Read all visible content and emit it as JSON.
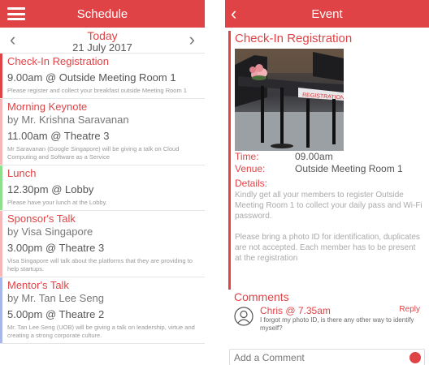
{
  "schedule": {
    "header": {
      "title": "Schedule",
      "menu_icon": "hamburger-menu-icon"
    },
    "date_nav": {
      "today_label": "Today",
      "date": "21 July 2017",
      "prev_icon": "chevron-left-icon",
      "next_icon": "chevron-right-icon"
    },
    "events": [
      {
        "title": "Check-In Registration",
        "time": "9.00am @ Outside Meeting Room 1",
        "description": "Please register and collect your breakfast outside Meeting Room 1",
        "color": "#e04346"
      },
      {
        "title": "Morning Keynote",
        "speaker": "by Mr. Krishna Saravanan",
        "time": "11.00am @ Theatre 3",
        "description": "Mr Saravanan (Google Singapore) will be giving a talk on Cloud Computing and Software as a Service",
        "color": "#f4b6b7"
      },
      {
        "title": "Lunch",
        "time": "12.30pm @ Lobby",
        "description": "Please have your lunch at the Lobby.",
        "color": "#8fe08c"
      },
      {
        "title": "Sponsor's Talk",
        "speaker": "by Visa Singapore",
        "time": "3.00pm @ Theatre 3",
        "description": "Visa Singapore will talk about the platforms that they are providing to help startups.",
        "color": "#f4b6b7"
      },
      {
        "title": "Mentor's Talk",
        "speaker": "by Mr. Tan Lee Seng",
        "time": "5.00pm @ Theatre 2",
        "description": "Mr. Tan Lee Seng (UOB) will be giving a talk on leadership, virtue and creating a strong corporate culture.",
        "color": "#a8b7ea"
      }
    ]
  },
  "event": {
    "header": {
      "title": "Event",
      "back_icon": "chevron-left-icon"
    },
    "title": "Check-In Registration",
    "photo_sign_text": "REGISTRATION",
    "time_label": "Time:",
    "time_value": "09.00am",
    "venue_label": "Venue:",
    "venue_value": "Outside Meeting Room 1",
    "details_label": "Details:",
    "details_p1": "Kindly get all your members to register Outside Meeting Room 1 to collect your daily pass and Wi-Fi password.",
    "details_p2": "Please bring a photo ID for identification, duplicates are not accepted. Each member has to be present at the registration",
    "accent_color": "#e04346",
    "comments": {
      "heading": "Comments",
      "items": [
        {
          "author": "Chris @ 7.35am",
          "text": "I forgot my photo ID, is there any other way to identify myself?",
          "reply_label": "Reply",
          "avatar_icon": "user-avatar-icon"
        }
      ],
      "input_placeholder": "Add a Comment",
      "send_icon": "send-dot-icon"
    }
  }
}
